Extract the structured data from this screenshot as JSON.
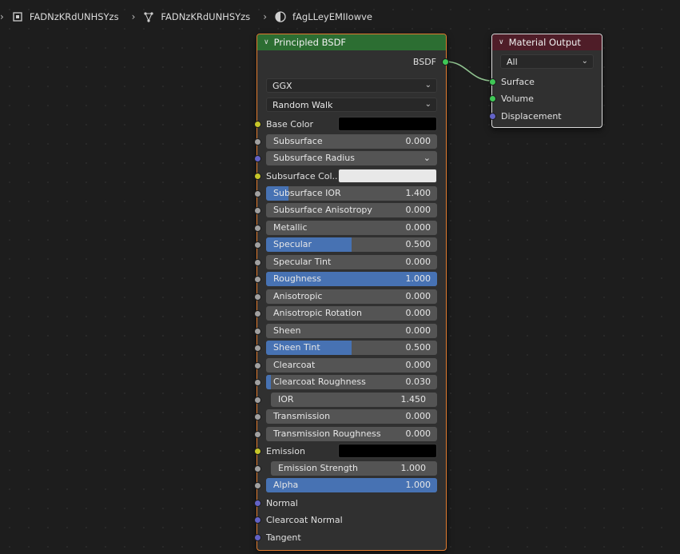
{
  "breadcrumb": {
    "items": [
      {
        "label": "FADNzKRdUNHSYzs",
        "icon": "object-icon"
      },
      {
        "label": "FADNzKRdUNHSYzs",
        "icon": "mesh-icon"
      },
      {
        "label": "fAgLLeyEMIIowve",
        "icon": "material-icon"
      }
    ]
  },
  "bsdf_node": {
    "title": "Principled BSDF",
    "output_label": "BSDF",
    "distribution": "GGX",
    "subsurface_method": "Random Walk",
    "inputs": {
      "base_color": {
        "label": "Base Color",
        "color": "#000000"
      },
      "subsurface": {
        "label": "Subsurface",
        "value": "0.000",
        "fill": 0
      },
      "subsurface_radius": {
        "label": "Subsurface Radius"
      },
      "subsurface_color": {
        "label": "Subsurface Col...",
        "color": "#e8e8e8"
      },
      "subsurface_ior": {
        "label": "Subsurface IOR",
        "value": "1.400",
        "fill": 0.13
      },
      "subsurface_anisotropy": {
        "label": "Subsurface Anisotropy",
        "value": "0.000",
        "fill": 0
      },
      "metallic": {
        "label": "Metallic",
        "value": "0.000",
        "fill": 0
      },
      "specular": {
        "label": "Specular",
        "value": "0.500",
        "fill": 0.5
      },
      "specular_tint": {
        "label": "Specular Tint",
        "value": "0.000",
        "fill": 0
      },
      "roughness": {
        "label": "Roughness",
        "value": "1.000",
        "fill": 1.0
      },
      "anisotropic": {
        "label": "Anisotropic",
        "value": "0.000",
        "fill": 0
      },
      "anisotropic_rotation": {
        "label": "Anisotropic Rotation",
        "value": "0.000",
        "fill": 0
      },
      "sheen": {
        "label": "Sheen",
        "value": "0.000",
        "fill": 0
      },
      "sheen_tint": {
        "label": "Sheen Tint",
        "value": "0.500",
        "fill": 0.5
      },
      "clearcoat": {
        "label": "Clearcoat",
        "value": "0.000",
        "fill": 0
      },
      "clearcoat_roughness": {
        "label": "Clearcoat Roughness",
        "value": "0.030",
        "fill": 0.03
      },
      "ior": {
        "label": "IOR",
        "value": "1.450"
      },
      "transmission": {
        "label": "Transmission",
        "value": "0.000",
        "fill": 0
      },
      "transmission_roughness": {
        "label": "Transmission Roughness",
        "value": "0.000",
        "fill": 0
      },
      "emission": {
        "label": "Emission",
        "color": "#000000"
      },
      "emission_strength": {
        "label": "Emission Strength",
        "value": "1.000"
      },
      "alpha": {
        "label": "Alpha",
        "value": "1.000",
        "fill": 1.0
      },
      "normal": {
        "label": "Normal"
      },
      "clearcoat_normal": {
        "label": "Clearcoat Normal"
      },
      "tangent": {
        "label": "Tangent"
      }
    }
  },
  "output_node": {
    "title": "Material Output",
    "target": "All",
    "inputs": {
      "surface": "Surface",
      "volume": "Volume",
      "displacement": "Displacement"
    }
  },
  "colors": {
    "accent_blue": "#4772b3",
    "bsdf_header": "#2c6e32",
    "output_header": "#4f1d28",
    "selected_border": "#e07b2e",
    "wire": "#8fc28f"
  }
}
